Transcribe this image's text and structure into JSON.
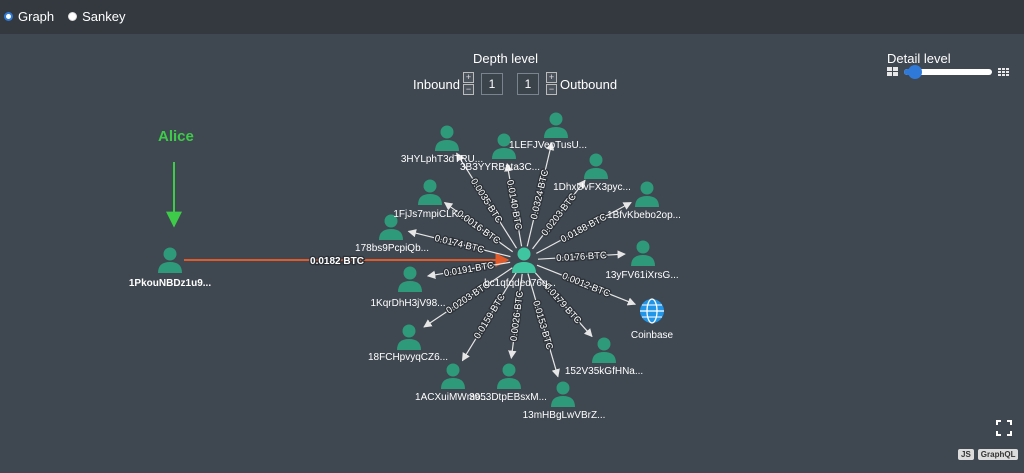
{
  "view_mode": {
    "options": [
      {
        "label": "Graph",
        "selected": true
      },
      {
        "label": "Sankey",
        "selected": false
      }
    ]
  },
  "depth": {
    "title": "Depth level",
    "inbound_label": "Inbound",
    "outbound_label": "Outbound",
    "inbound_value": "1",
    "outbound_value": "1"
  },
  "detail": {
    "title": "Detail level",
    "level_fraction": 0.12
  },
  "annotation": {
    "label": "Alice",
    "color": "#3ecb4a"
  },
  "colors": {
    "node": "#2e9a7a",
    "center": "#3fc6a0",
    "coinbase": "#2196e8",
    "inbound_edge": "#e05a2a",
    "edge": "#e6e6e6"
  },
  "graph": {
    "center": {
      "label": "bc1qfqded76q..."
    },
    "inbound": [
      {
        "label": "1PkouNBDz1u9...",
        "amount": "0.0182 BTC"
      }
    ],
    "outbound": [
      {
        "label": "3HYLphT3dTRU...",
        "amount": "0.0035 BTC"
      },
      {
        "label": "3B3YYRBata3C...",
        "amount": "0.0140 BTC"
      },
      {
        "label": "1LEFJVepTusU...",
        "amount": "0.0324 BTC"
      },
      {
        "label": "1DhxUvFX3pyc...",
        "amount": "0.0203 BTC"
      },
      {
        "label": "1BfvKbebo2op...",
        "amount": "0.0188 BTC"
      },
      {
        "label": "13yFV61iXrsG...",
        "amount": "0.0176 BTC"
      },
      {
        "label": "Coinbase",
        "amount": "0.0012 BTC",
        "icon": "globe-icon"
      },
      {
        "label": "152V35kGfHNa...",
        "amount": "0.0179 BTC"
      },
      {
        "label": "13mHBgLwVBrZ...",
        "amount": "0.0153 BTC"
      },
      {
        "label": "3953DtpEBsxM...",
        "amount": "0.0026 BTC"
      },
      {
        "label": "1ACXuiMWmo...",
        "amount": "0.0159 BTC"
      },
      {
        "label": "18FCHpvyqCZ6...",
        "amount": "0.0203 BTC"
      },
      {
        "label": "1KqrDhH3jV98...",
        "amount": "0.0191 BTC"
      },
      {
        "label": "178bs9PcpiQb...",
        "amount": "0.0174 BTC"
      },
      {
        "label": "1FjJs7mpiCLK...",
        "amount": "0.0016 BTC"
      }
    ]
  },
  "badges": [
    "JS",
    "GraphQL"
  ]
}
